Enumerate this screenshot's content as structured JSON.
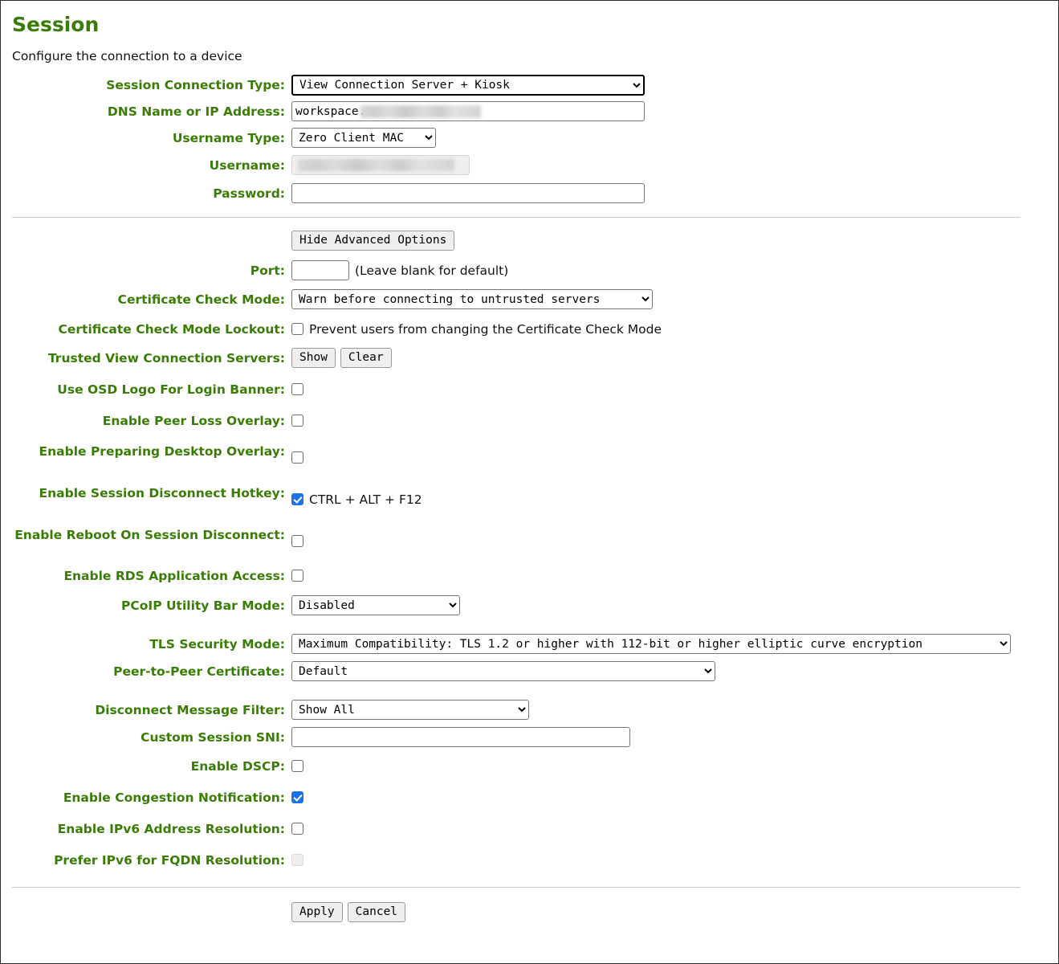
{
  "header": {
    "title": "Session",
    "subtitle": "Configure the connection to a device"
  },
  "basic": {
    "connection_type": {
      "label": "Session Connection Type:",
      "value": "View Connection Server + Kiosk",
      "options": [
        "View Connection Server + Kiosk"
      ]
    },
    "dns_name": {
      "label": "DNS Name or IP Address:",
      "value": "workspace.",
      "redacted": true
    },
    "username_type": {
      "label": "Username Type:",
      "value": "Zero Client MAC",
      "options": [
        "Zero Client MAC"
      ]
    },
    "username": {
      "label": "Username:",
      "value": "",
      "disabled": true,
      "redacted": true
    },
    "password": {
      "label": "Password:",
      "value": ""
    }
  },
  "advanced": {
    "toggle_button": "Hide Advanced Options",
    "port": {
      "label": "Port:",
      "value": "",
      "hint": "(Leave blank for default)"
    },
    "certificate_check_mode": {
      "label": "Certificate Check Mode:",
      "value": "Warn before connecting to untrusted servers",
      "options": [
        "Warn before connecting to untrusted servers"
      ]
    },
    "certificate_check_mode_lockout": {
      "label": "Certificate Check Mode Lockout:",
      "checked": false,
      "text": "Prevent users from changing the Certificate Check Mode"
    },
    "trusted_view_connection_servers": {
      "label": "Trusted View Connection Servers:",
      "show_button": "Show",
      "clear_button": "Clear"
    },
    "use_osd_logo": {
      "label": "Use OSD Logo For Login Banner:",
      "checked": false
    },
    "enable_peer_loss_overlay": {
      "label": "Enable Peer Loss Overlay:",
      "checked": false
    },
    "enable_preparing_desktop_overlay": {
      "label": "Enable Preparing Desktop Overlay:",
      "checked": false
    },
    "enable_session_disconnect_hotkey": {
      "label": "Enable Session Disconnect Hotkey:",
      "checked": true,
      "text": "CTRL + ALT + F12"
    },
    "enable_reboot_on_session_disconnect": {
      "label": "Enable Reboot On Session Disconnect:",
      "checked": false
    },
    "enable_rds_application_access": {
      "label": "Enable RDS Application Access:",
      "checked": false
    },
    "pcoip_utility_bar_mode": {
      "label": "PCoIP Utility Bar Mode:",
      "value": "Disabled",
      "options": [
        "Disabled"
      ]
    },
    "tls_security_mode": {
      "label": "TLS Security Mode:",
      "value": "Maximum Compatibility: TLS 1.2 or higher with 112-bit or higher elliptic curve encryption",
      "options": [
        "Maximum Compatibility: TLS 1.2 or higher with 112-bit or higher elliptic curve encryption"
      ]
    },
    "peer_to_peer_certificate": {
      "label": "Peer-to-Peer Certificate:",
      "value": "Default",
      "options": [
        "Default"
      ]
    },
    "disconnect_message_filter": {
      "label": "Disconnect Message Filter:",
      "value": "Show All",
      "options": [
        "Show All"
      ]
    },
    "custom_session_sni": {
      "label": "Custom Session SNI:",
      "value": ""
    },
    "enable_dscp": {
      "label": "Enable DSCP:",
      "checked": false
    },
    "enable_congestion_notification": {
      "label": "Enable Congestion Notification:",
      "checked": true
    },
    "enable_ipv6_address_resolution": {
      "label": "Enable IPv6 Address Resolution:",
      "checked": false
    },
    "prefer_ipv6_for_fqdn_resolution": {
      "label": "Prefer IPv6 for FQDN Resolution:",
      "checked": false,
      "disabled": true
    }
  },
  "footer": {
    "apply_button": "Apply",
    "cancel_button": "Cancel"
  },
  "colors": {
    "label_green": "#3a7d06",
    "checkbox_blue": "#1a73e8",
    "divider": "#c9c9c9"
  }
}
